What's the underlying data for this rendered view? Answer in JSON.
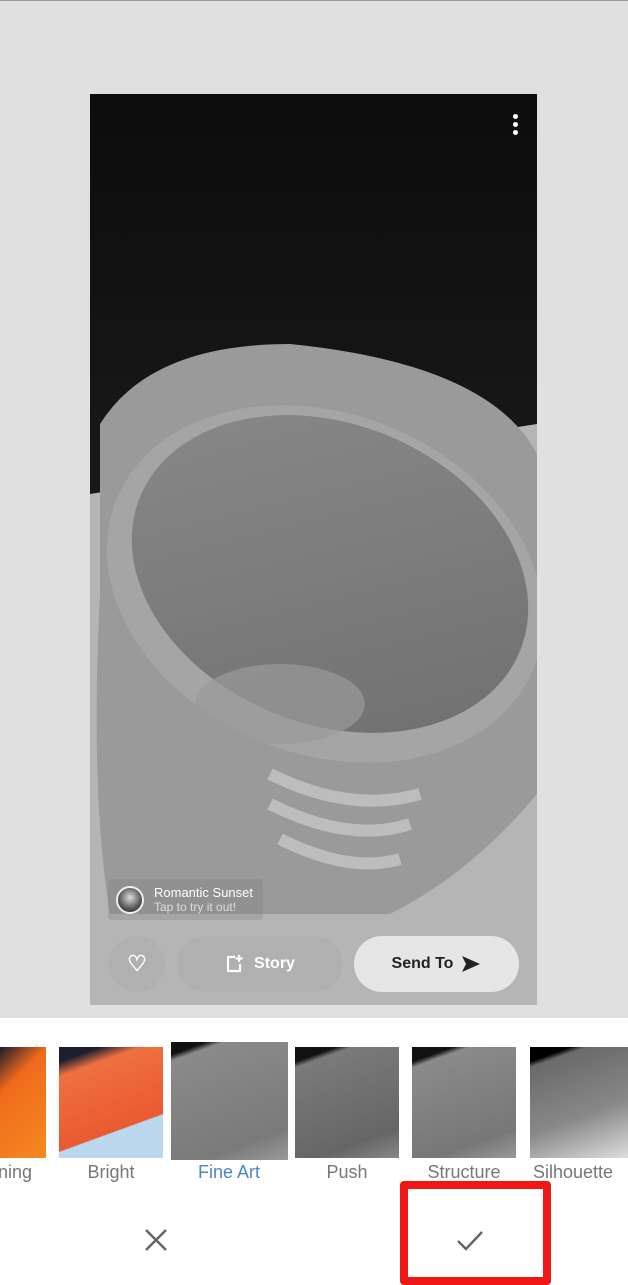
{
  "photo": {
    "lens_title": "Romantic Sunset",
    "lens_subtitle": "Tap to try it out!",
    "story_label": "Story",
    "send_label": "Send To"
  },
  "filters": {
    "selected": "Fine Art",
    "items": [
      {
        "label": "ning",
        "tint": "#f06a1c"
      },
      {
        "label": "Bright",
        "tint": "#ea6a3a"
      },
      {
        "label": "Fine Art",
        "tint": "#8a8a8a"
      },
      {
        "label": "Push",
        "tint": "#7a7a7a"
      },
      {
        "label": "Structure",
        "tint": "#8a8a8a"
      },
      {
        "label": "Silhouette",
        "tint": "#777777"
      }
    ]
  },
  "colors": {
    "accent": "#4a86c8",
    "highlight": "#f01616"
  }
}
